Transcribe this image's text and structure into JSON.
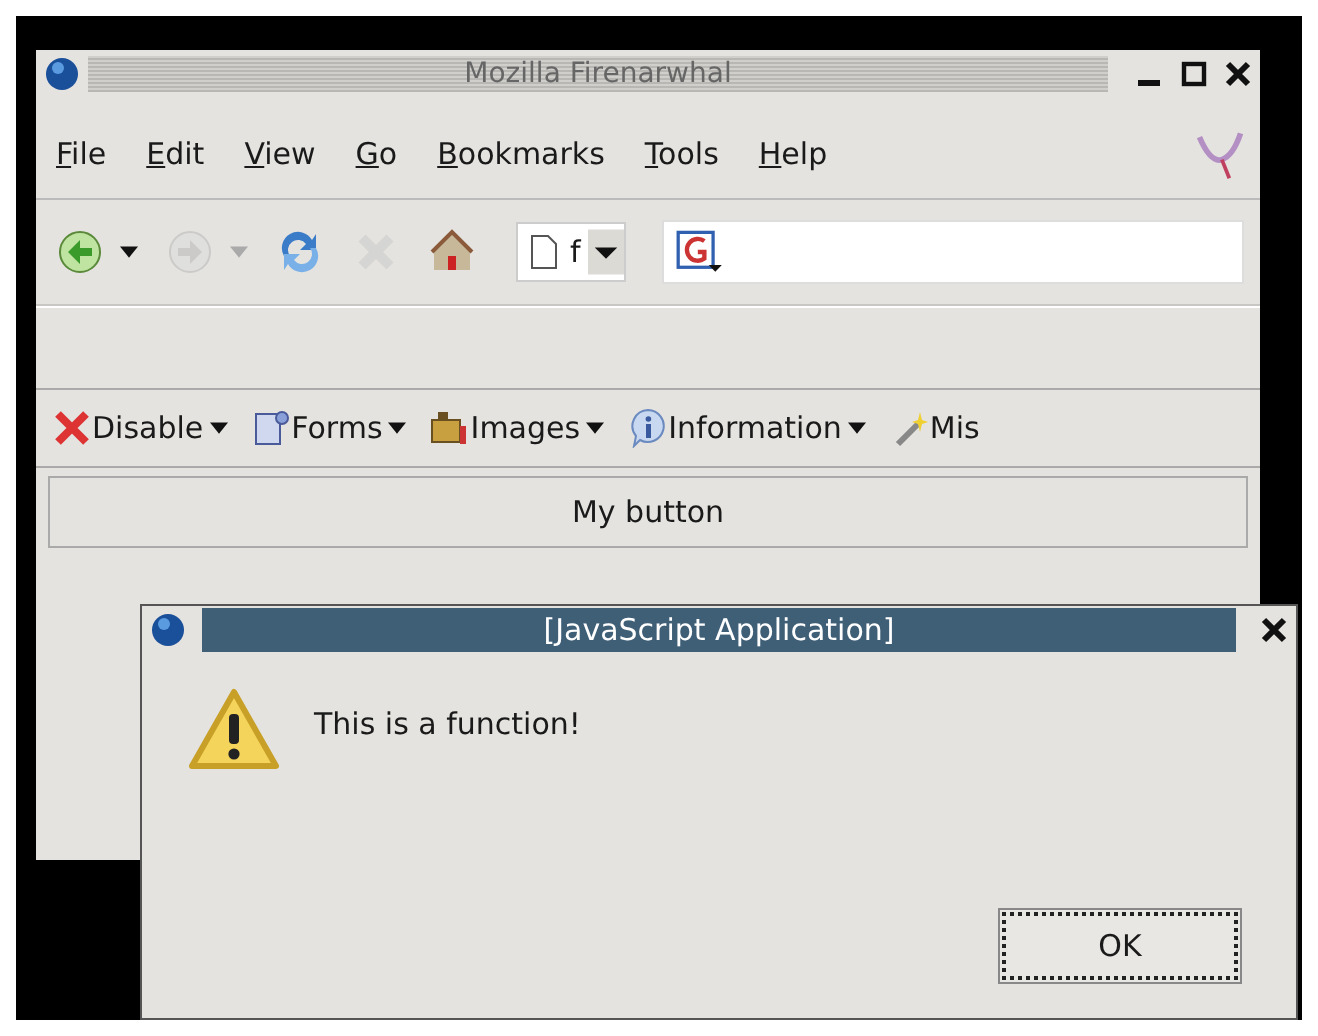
{
  "browser": {
    "title": "Mozilla Firenarwhal",
    "menu": [
      "File",
      "Edit",
      "View",
      "Go",
      "Bookmarks",
      "Tools",
      "Help"
    ],
    "nav_buttons": [
      {
        "kind": "back",
        "disabled": false
      },
      {
        "kind": "forward",
        "disabled": true
      },
      {
        "kind": "reload",
        "disabled": false
      },
      {
        "kind": "stop",
        "disabled": true
      },
      {
        "kind": "home",
        "disabled": false
      }
    ],
    "address": {
      "value": "f"
    },
    "webdev_toolbar": [
      {
        "kind": "disable",
        "label": "Disable"
      },
      {
        "kind": "forms",
        "label": "Forms"
      },
      {
        "kind": "images",
        "label": "Images"
      },
      {
        "kind": "information",
        "label": "Information"
      },
      {
        "kind": "misc",
        "label": "Mis"
      }
    ],
    "page": {
      "button": "My button"
    }
  },
  "dialog": {
    "title": "[JavaScript Application]",
    "message": "This is a function!",
    "button": {
      "label": "OK",
      "focused": true
    }
  }
}
